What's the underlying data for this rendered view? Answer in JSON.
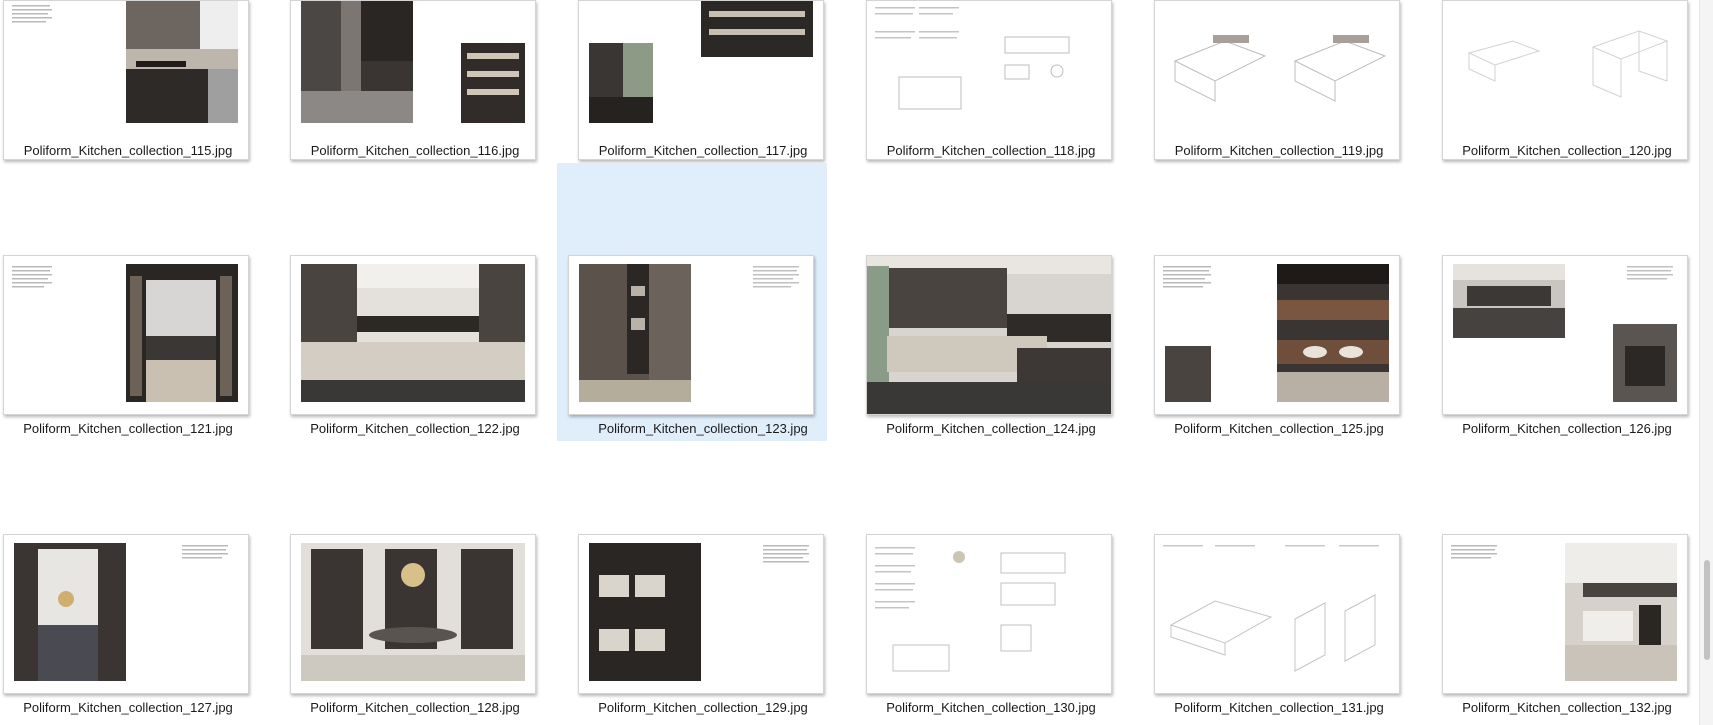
{
  "files": [
    {
      "name": "Poliform_Kitchen_collection_115.jpg",
      "kind": "text-left-photo-right"
    },
    {
      "name": "Poliform_Kitchen_collection_116.jpg",
      "kind": "photo-left-small-photo-right"
    },
    {
      "name": "Poliform_Kitchen_collection_117.jpg",
      "kind": "small-photos"
    },
    {
      "name": "Poliform_Kitchen_collection_118.jpg",
      "kind": "technical-text"
    },
    {
      "name": "Poliform_Kitchen_collection_119.jpg",
      "kind": "line-drawings"
    },
    {
      "name": "Poliform_Kitchen_collection_120.jpg",
      "kind": "light-line-drawings"
    },
    {
      "name": "Poliform_Kitchen_collection_121.jpg",
      "kind": "text-left-photo-right"
    },
    {
      "name": "Poliform_Kitchen_collection_122.jpg",
      "kind": "wide-kitchen-photo"
    },
    {
      "name": "Poliform_Kitchen_collection_123.jpg",
      "kind": "door-photo-text-right"
    },
    {
      "name": "Poliform_Kitchen_collection_124.jpg",
      "kind": "full-bleed-kitchen"
    },
    {
      "name": "Poliform_Kitchen_collection_125.jpg",
      "kind": "drawers-photos"
    },
    {
      "name": "Poliform_Kitchen_collection_126.jpg",
      "kind": "kitchen-photos-text"
    },
    {
      "name": "Poliform_Kitchen_collection_127.jpg",
      "kind": "photo-left-text-right"
    },
    {
      "name": "Poliform_Kitchen_collection_128.jpg",
      "kind": "dining-room"
    },
    {
      "name": "Poliform_Kitchen_collection_129.jpg",
      "kind": "glass-cabinet-text-right"
    },
    {
      "name": "Poliform_Kitchen_collection_130.jpg",
      "kind": "technical-text"
    },
    {
      "name": "Poliform_Kitchen_collection_131.jpg",
      "kind": "line-drawings"
    },
    {
      "name": "Poliform_Kitchen_collection_132.jpg",
      "kind": "text-left-photo-right-light"
    }
  ],
  "selected_index": 8,
  "colors": {
    "selection": "#e0eefc",
    "wood_dark": "#3b3531",
    "wood_light": "#d9d2c8"
  },
  "icons": {
    "file": "image-file-icon",
    "scroll": "vertical-scrollbar"
  }
}
